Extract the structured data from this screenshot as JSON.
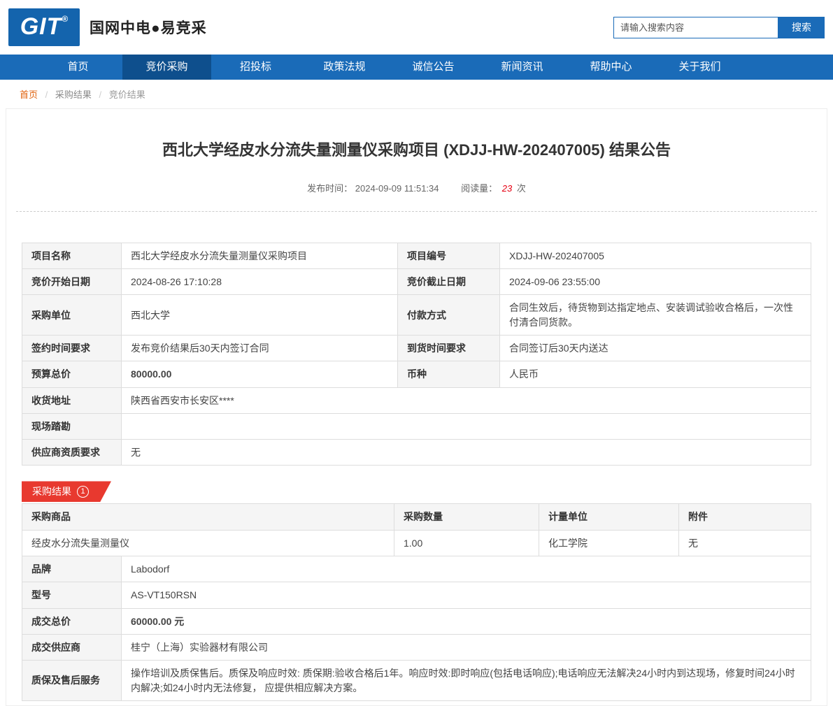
{
  "colors": {
    "nav_blue": "#1a6bb8",
    "nav_active_blue": "#0e4f8d",
    "logo_blue": "#1464ad",
    "accent_red": "#e60012",
    "ribbon_red": "#e8392f"
  },
  "header": {
    "logo_text": "GIT",
    "logo_reg": "®",
    "site_title": "国网中电●易竞采",
    "search_placeholder": "请输入搜索内容",
    "search_button": "搜索"
  },
  "nav": {
    "items": [
      {
        "label": "首页"
      },
      {
        "label": "竞价采购"
      },
      {
        "label": "招投标"
      },
      {
        "label": "政策法规"
      },
      {
        "label": "诚信公告"
      },
      {
        "label": "新闻资讯"
      },
      {
        "label": "帮助中心"
      },
      {
        "label": "关于我们"
      }
    ]
  },
  "breadcrumb": {
    "separator": "/",
    "items": [
      "首页",
      "采购结果",
      "竞价结果"
    ]
  },
  "article": {
    "title": "西北大学经皮水分流失量测量仪采购项目 (XDJJ-HW-202407005) 结果公告",
    "publish_label": "发布时间：",
    "publish_time": "2024-09-09 11:51:34",
    "views_label": "阅读量：",
    "views_count": "23",
    "views_unit": "次"
  },
  "info": {
    "project_name": {
      "label": "项目名称",
      "value": "西北大学经皮水分流失量测量仪采购项目"
    },
    "project_no": {
      "label": "项目编号",
      "value": "XDJJ-HW-202407005"
    },
    "bid_start": {
      "label": "竞价开始日期",
      "value": "2024-08-26 17:10:28"
    },
    "bid_end": {
      "label": "竞价截止日期",
      "value": "2024-09-06 23:55:00"
    },
    "purchaser": {
      "label": "采购单位",
      "value": "西北大学"
    },
    "payment": {
      "label": "付款方式",
      "value": "合同生效后，待货物到达指定地点、安装调试验收合格后，一次性付清合同货款。"
    },
    "sign_time": {
      "label": "签约时间要求",
      "value": "发布竞价结果后30天内签订合同"
    },
    "delivery_time": {
      "label": "到货时间要求",
      "value": "合同签订后30天内送达"
    },
    "budget": {
      "label": "预算总价",
      "value": "80000.00"
    },
    "currency": {
      "label": "币种",
      "value": "人民币"
    },
    "address": {
      "label": "收货地址",
      "value": "陕西省西安市长安区****"
    },
    "site_visit": {
      "label": "现场踏勘",
      "value": ""
    },
    "qualification": {
      "label": "供应商资质要求",
      "value": "无"
    }
  },
  "result": {
    "badge_label": "采购结果",
    "badge_count": "1",
    "headers": [
      "采购商品",
      "采购数量",
      "计量单位",
      "附件"
    ],
    "item": {
      "product": "经皮水分流失量测量仪",
      "quantity": "1.00",
      "unit": "化工学院",
      "attachment": "无"
    },
    "brand": {
      "label": "品牌",
      "value": "Labodorf"
    },
    "model": {
      "label": "型号",
      "value": "AS-VT150RSN"
    },
    "total": {
      "label": "成交总价",
      "value": "60000.00 元"
    },
    "supplier": {
      "label": "成交供应商",
      "value": "桂宁（上海）实验器材有限公司"
    },
    "warranty": {
      "label": "质保及售后服务",
      "value": "操作培训及质保售后。质保及响应时效: 质保期:验收合格后1年。响应时效:即时响应(包括电话响应);电话响应无法解决24小时内到达现场，修复时间24小时内解决;如24小时内无法修复， 应提供相应解决方案。"
    }
  }
}
